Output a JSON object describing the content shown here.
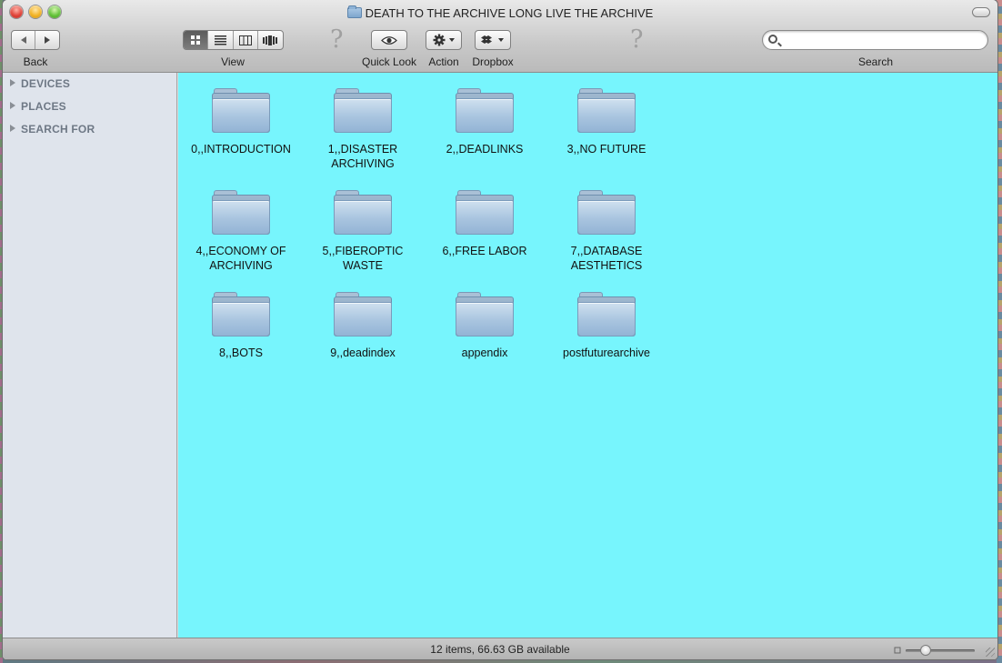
{
  "window": {
    "title": "DEATH TO THE ARCHIVE LONG LIVE THE ARCHIVE"
  },
  "toolbar": {
    "back_label": "Back",
    "view_label": "View",
    "quicklook_label": "Quick Look",
    "action_label": "Action",
    "dropbox_label": "Dropbox",
    "search_label": "Search",
    "search_value": "",
    "search_placeholder": ""
  },
  "sidebar": {
    "sections": [
      {
        "label": "DEVICES"
      },
      {
        "label": "PLACES"
      },
      {
        "label": "SEARCH FOR"
      }
    ]
  },
  "content": {
    "background": "#77f5fd",
    "items": [
      {
        "label": "0,,INTRODUCTION"
      },
      {
        "label": "1,,DISASTER ARCHIVING"
      },
      {
        "label": "2,,DEADLINKS"
      },
      {
        "label": "3,,NO FUTURE"
      },
      {
        "label": "4,,ECONOMY OF ARCHIVING"
      },
      {
        "label": "5,,FIBEROPTIC WASTE"
      },
      {
        "label": "6,,FREE LABOR"
      },
      {
        "label": "7,,DATABASE AESTHETICS"
      },
      {
        "label": "8,,BOTS"
      },
      {
        "label": "9,,deadindex"
      },
      {
        "label": "appendix"
      },
      {
        "label": "postfuturearchive"
      }
    ]
  },
  "statusbar": {
    "text": "12 items, 66.63 GB available",
    "icon_size_level": 0.25
  },
  "icons": {
    "back": "back-arrow-icon",
    "forward": "forward-arrow-icon",
    "view_icons": "icon-view-icon",
    "view_list": "list-view-icon",
    "view_columns": "column-view-icon",
    "view_coverflow": "coverflow-view-icon",
    "quicklook": "eye-icon",
    "action": "gear-icon",
    "dropbox": "dropbox-icon",
    "search": "magnifier-icon",
    "folder": "folder-icon"
  }
}
